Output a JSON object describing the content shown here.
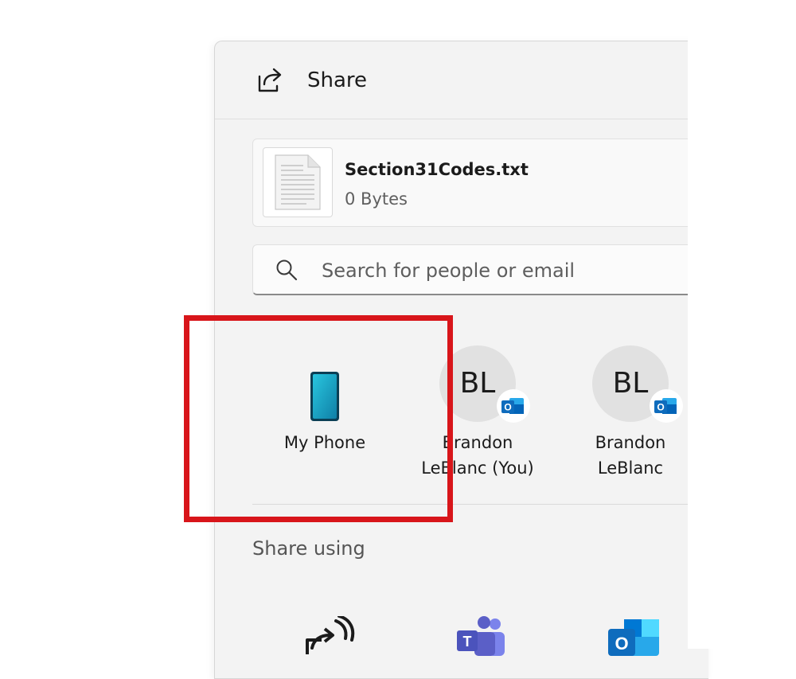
{
  "header": {
    "title": "Share",
    "icon": "share-icon"
  },
  "file": {
    "name": "Section31Codes.txt",
    "size": "0 Bytes",
    "icon": "text-file-icon"
  },
  "search": {
    "placeholder": "Search for people or email",
    "value": "",
    "icon": "search-icon"
  },
  "targets": [
    {
      "label": "My Phone",
      "icon": "phone-icon"
    },
    {
      "initials": "BL",
      "label_line1": "Brandon",
      "label_line2": "LeBlanc (You)",
      "badge": "outlook-badge-icon"
    },
    {
      "initials": "BL",
      "label_line1": "Brandon",
      "label_line2": "LeBlanc",
      "badge": "outlook-badge-icon"
    }
  ],
  "share_using": {
    "title": "Share using",
    "apps": [
      {
        "icon": "nearby-share-icon"
      },
      {
        "icon": "teams-icon"
      },
      {
        "icon": "outlook-icon"
      }
    ]
  },
  "colors": {
    "highlight": "#d8151a",
    "outlook": "#0f6cbd",
    "teams": "#5b5fc7",
    "phone": "#1aa5c4"
  }
}
